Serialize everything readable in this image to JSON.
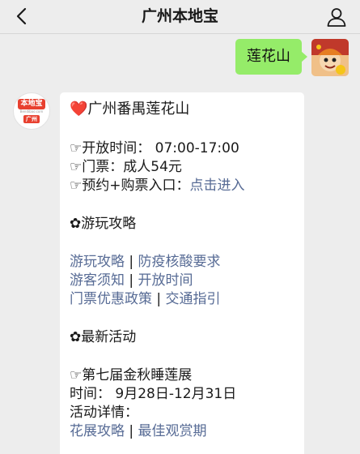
{
  "nav": {
    "title": "广州本地宝"
  },
  "user_message": {
    "text": "莲花山"
  },
  "bot_avatar": {
    "logo_text": "本地宝",
    "logo_sub": "Bendibao.com",
    "logo_city": "广州"
  },
  "bot_message": {
    "heart": "❤️",
    "title": "广州番禺莲花山",
    "hand": "☞",
    "flower": "✿",
    "open_time": "开放时间： 07:00-17:00",
    "ticket": "门票：成人54元",
    "booking_prefix": "预约+购票入口：",
    "booking_link": "点击进入",
    "guide_heading": "游玩攻略",
    "guide_links": {
      "l1": "游玩攻略",
      "l2": "防疫核酸要求",
      "l3": "游客须知",
      "l4": "开放时间",
      "l5": "门票优惠政策",
      "l6": "交通指引",
      "separator": " | "
    },
    "activity_heading": "最新活动",
    "activity_title": "第七届金秋睡莲展",
    "activity_time": "时间： 9月28日-12月31日",
    "activity_detail": "活动详情：",
    "activity_links": {
      "a1": "花展攻略",
      "a2": "最佳观赏期"
    }
  }
}
